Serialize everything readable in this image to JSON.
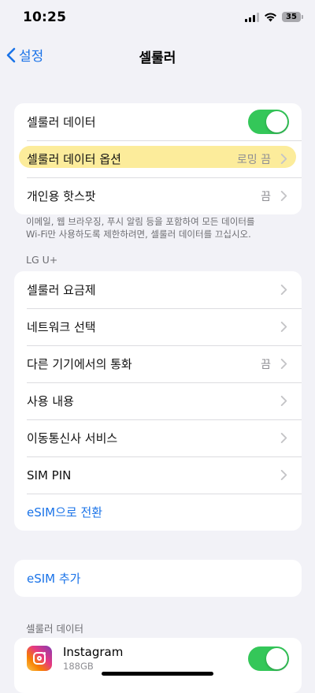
{
  "status_bar": {
    "time": "10:25",
    "battery": "35"
  },
  "nav": {
    "back_label": "설정",
    "title": "셀룰러"
  },
  "group1": {
    "rows": [
      {
        "label": "셀룰러 데이터",
        "toggle_on": true
      },
      {
        "label": "셀룰러 데이터 옵션",
        "value": "로밍 끔"
      },
      {
        "label": "개인용 핫스팟",
        "value": "끔"
      }
    ],
    "footnote_line1": "이메일, 웹 브라우징, 푸시 알림 등을 포함하여 모든 데이터를",
    "footnote_line2": "Wi-Fi만 사용하도록 제한하려면, 셀룰러 데이터를 끄십시오."
  },
  "carrier_section": {
    "header": "LG U+",
    "rows": [
      {
        "label": "셀룰러 요금제",
        "value": ""
      },
      {
        "label": "네트워크 선택",
        "value": ""
      },
      {
        "label": "다른 기기에서의 통화",
        "value": "끔"
      },
      {
        "label": "사용 내용",
        "value": ""
      },
      {
        "label": "이동통신사 서비스",
        "value": ""
      },
      {
        "label": "SIM PIN",
        "value": ""
      },
      {
        "label": "eSIM으로 전환"
      }
    ]
  },
  "esim_group": {
    "label": "eSIM 추가"
  },
  "cellular_data_section": {
    "header": "셀룰러 데이터",
    "apps": [
      {
        "name": "Instagram",
        "usage": "188GB",
        "toggle_on": true,
        "icon": "instagram-icon"
      }
    ]
  },
  "colors": {
    "accent": "#1a73e8",
    "toggle_on": "#34c759",
    "background": "#f2f2f7",
    "highlight": "#fbe98a"
  }
}
